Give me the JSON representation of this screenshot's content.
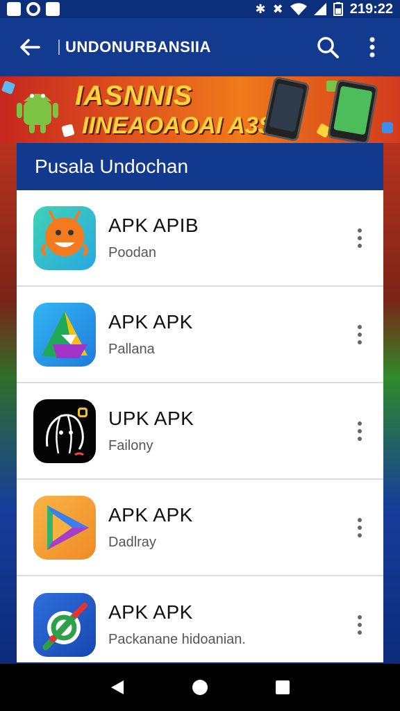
{
  "status_bar": {
    "time": "219:22"
  },
  "app_bar": {
    "title": "UNDONURBANSIIA"
  },
  "banner": {
    "line1": "IASNNIS",
    "line2": "IINEAOAOAI A3S"
  },
  "section": {
    "title": "Pusala Undochan"
  },
  "apps": [
    {
      "name": "APK APIB",
      "subtitle": "Poodan",
      "icon": "orange-bot-icon",
      "color": "#2cc2b9"
    },
    {
      "name": "APK APK",
      "subtitle": "Pallana",
      "icon": "triangle-logo-icon",
      "color": "#2b8ef0"
    },
    {
      "name": "UPK APK",
      "subtitle": "Failony",
      "icon": "sketch-bot-icon",
      "color": "#000000"
    },
    {
      "name": "APK APK",
      "subtitle": "Dadlray",
      "icon": "play-logo-icon",
      "color": "#f29a2e"
    },
    {
      "name": "APK APK",
      "subtitle": "Packanane hidoanian.",
      "icon": "wrench-globe-icon",
      "color": "#1a56c4"
    }
  ],
  "colors": {
    "app_bar": "#123a8e",
    "header": "#113a8f",
    "nav_bar": "#000000"
  }
}
